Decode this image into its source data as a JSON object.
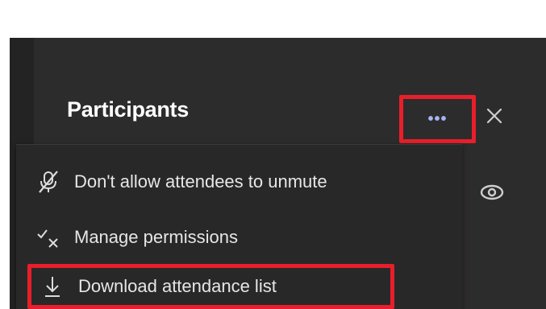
{
  "panel": {
    "title": "Participants",
    "more_label": "•••"
  },
  "menu": {
    "items": [
      {
        "label": "Don't allow attendees to unmute",
        "icon": "mic-off-icon"
      },
      {
        "label": "Manage permissions",
        "icon": "permissions-icon"
      },
      {
        "label": "Download attendance list",
        "icon": "download-icon"
      }
    ]
  },
  "colors": {
    "panel_bg": "#2d2c2c",
    "menu_bg": "#292828",
    "highlight": "#e81f2b",
    "accent": "#a8b3f5",
    "text": "#e6e6e6"
  }
}
